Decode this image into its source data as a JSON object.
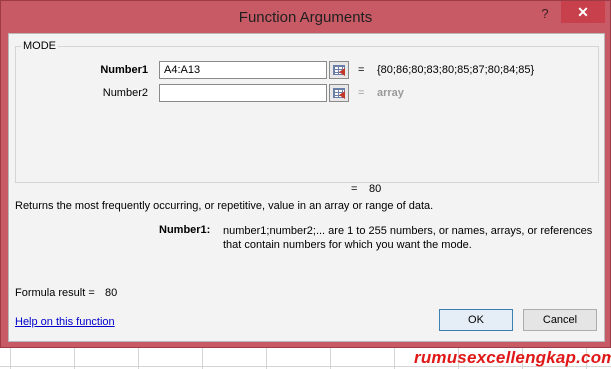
{
  "dialog": {
    "title": "Function Arguments",
    "help_glyph": "?",
    "close_glyph": "✕"
  },
  "function": {
    "name": "MODE",
    "args": [
      {
        "label": "Number1",
        "value": "A4:A13",
        "equals": "=",
        "evaluated": "{80;86;80;83;80;85;87;80;84;85}"
      },
      {
        "label": "Number2",
        "value": "",
        "equals": "=",
        "evaluated": "array"
      }
    ],
    "result_equals": "=",
    "result": "80",
    "description": "Returns the most frequently occurring, or repetitive, value in an array or range of data.",
    "arg_help_label": "Number1:",
    "arg_help_text": "number1;number2;... are 1 to 255 numbers, or names, arrays, or references that contain numbers for which you want the mode."
  },
  "formula": {
    "label": "Formula result =",
    "value": "80"
  },
  "footer": {
    "help_link": "Help on this function",
    "ok_label": "OK",
    "cancel_label": "Cancel"
  },
  "watermark": "rumusexcellengkap.com"
}
